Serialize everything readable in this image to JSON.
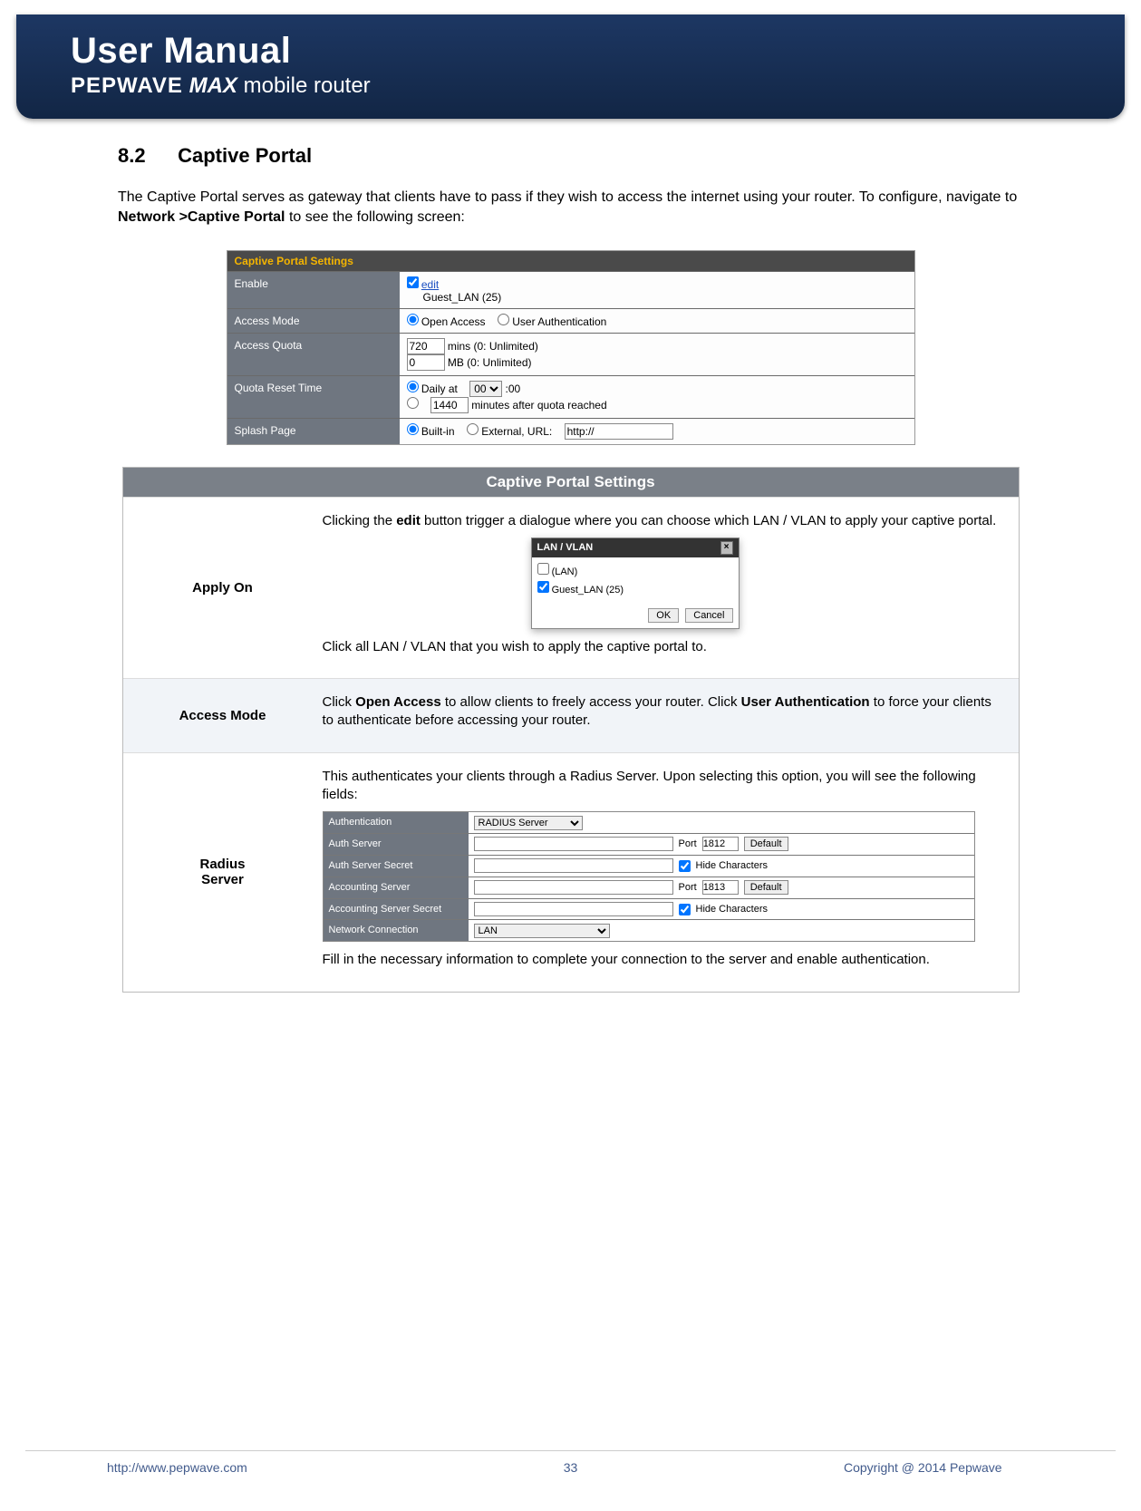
{
  "header": {
    "title": "User Manual",
    "brand": "PEPWAVE",
    "max": "MAX",
    "tail": "mobile router"
  },
  "section": {
    "number": "8.2",
    "title": "Captive Portal"
  },
  "intro": {
    "t1": "The Captive Portal serves as gateway that clients have to pass if they wish to access the internet using your router. To configure, navigate to ",
    "b1": "Network >Captive Portal",
    "t2": " to see the following screen:"
  },
  "settings_panel": {
    "header": "Captive Portal Settings",
    "rows": {
      "enable": {
        "label": "Enable",
        "edit": "edit",
        "lan_name": "Guest_LAN (25)"
      },
      "access_mode": {
        "label": "Access Mode",
        "opt1": "Open Access",
        "opt2": "User Authentication"
      },
      "access_quota": {
        "label": "Access Quota",
        "mins_value": "720",
        "mins_label": "mins (0: Unlimited)",
        "mb_value": "0",
        "mb_label": "MB (0: Unlimited)"
      },
      "quota_reset": {
        "label": "Quota Reset Time",
        "daily": "Daily at",
        "hour_sel": "00",
        "hour_sfx": ":00",
        "mins_value": "1440",
        "mins_label": "minutes after quota reached"
      },
      "splash": {
        "label": "Splash Page",
        "opt1": "Built-in",
        "opt2": "External, URL:",
        "url": "http://"
      }
    }
  },
  "desc_table": {
    "header": "Captive Portal Settings",
    "rows": [
      {
        "label": "Apply On",
        "p1a": "Clicking the ",
        "p1b": "edit",
        "p1c": " button trigger a dialogue where you can choose which LAN / VLAN to apply your captive portal.",
        "dialog": {
          "title": "LAN / VLAN",
          "item1": "(LAN)",
          "item2": "Guest_LAN (25)",
          "ok": "OK",
          "cancel": "Cancel"
        },
        "p2": "Click all LAN / VLAN that you wish to apply the captive portal to."
      },
      {
        "label": "Access Mode",
        "p1a": "Click ",
        "p1b": "Open Access",
        "p1c": " to allow clients to freely access your router. Click ",
        "p1d": "User Authentication",
        "p1e": " to force your clients to authenticate before accessing your router."
      },
      {
        "label1": "Radius",
        "label2": "Server",
        "p1": "This authenticates your clients through a Radius Server. Upon selecting this option, you will see the following fields:",
        "p2": "Fill in the necessary information to complete your connection to the server and enable authentication.",
        "radius": {
          "r_auth_label": "Authentication",
          "r_auth_val": "RADIUS Server",
          "r_srv_label": "Auth Server",
          "r_port_label": "Port",
          "r_port1": "1812",
          "r_default": "Default",
          "r_sec_label": "Auth Server Secret",
          "r_hide": "Hide Characters",
          "r_acct_label": "Accounting Server",
          "r_port2": "1813",
          "r_asec_label": "Accounting Server Secret",
          "r_net_label": "Network Connection",
          "r_net_val": "LAN"
        }
      }
    ]
  },
  "footer": {
    "url": "http://www.pepwave.com",
    "page": "33",
    "copy": "Copyright @ 2014 Pepwave"
  }
}
